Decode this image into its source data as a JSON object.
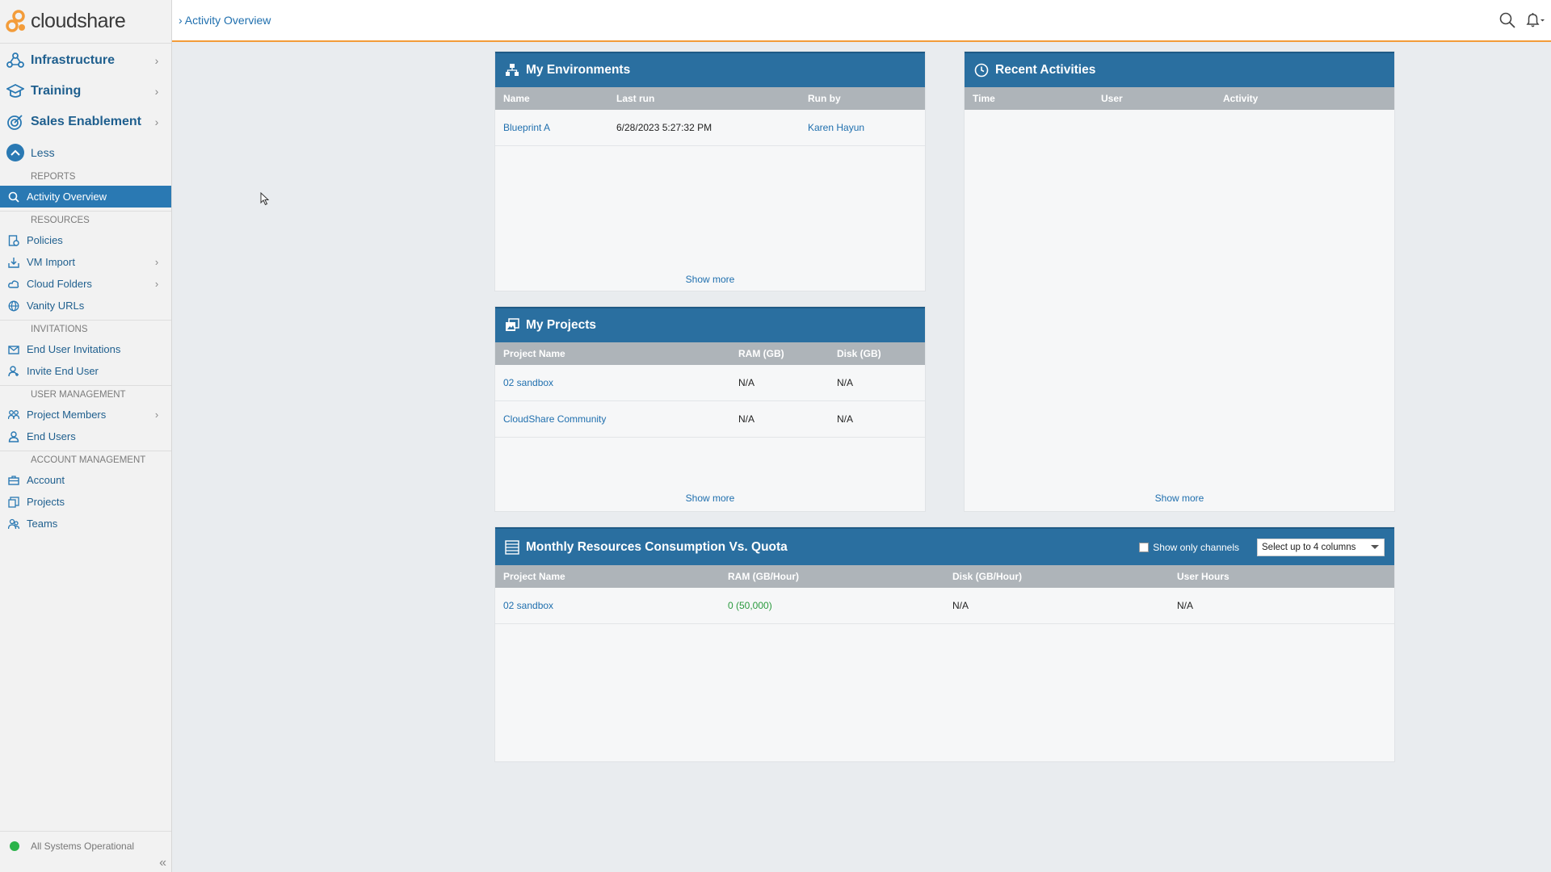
{
  "app": {
    "logo_text": "cloudshare",
    "brand_color": "#f39c3a",
    "accent_color": "#2a79b3"
  },
  "breadcrumb": {
    "separator": "›",
    "current": "Activity Overview"
  },
  "sidebar": {
    "main": [
      {
        "label": "Infrastructure",
        "icon": "infrastructure-icon"
      },
      {
        "label": "Training",
        "icon": "graduation-cap-icon"
      },
      {
        "label": "Sales Enablement",
        "icon": "target-icon"
      }
    ],
    "less_label": "Less",
    "sections": {
      "reports": "REPORTS",
      "resources": "RESOURCES",
      "invitations": "INVITATIONS",
      "user_management": "USER MANAGEMENT",
      "account_management": "ACCOUNT MANAGEMENT"
    },
    "items": {
      "activity_overview": "Activity Overview",
      "policies": "Policies",
      "vm_import": "VM Import",
      "cloud_folders": "Cloud Folders",
      "vanity_urls": "Vanity URLs",
      "end_user_invitations": "End User Invitations",
      "invite_end_user": "Invite End User",
      "project_members": "Project Members",
      "end_users": "End Users",
      "account": "Account",
      "projects": "Projects",
      "teams": "Teams"
    },
    "status": "All Systems Operational",
    "status_color": "#2bb34a"
  },
  "environments": {
    "title": "My Environments",
    "columns": [
      "Name",
      "Last run",
      "Run by"
    ],
    "rows": [
      {
        "name": "Blueprint A",
        "last_run": "6/28/2023 5:27:32 PM",
        "run_by": "Karen Hayun"
      }
    ],
    "show_more": "Show more"
  },
  "recent": {
    "title": "Recent Activities",
    "columns": [
      "Time",
      "User",
      "Activity"
    ],
    "show_more": "Show more"
  },
  "projects": {
    "title": "My Projects",
    "columns": [
      "Project Name",
      "RAM (GB)",
      "Disk (GB)"
    ],
    "rows": [
      {
        "name": "02 sandbox",
        "ram": "N/A",
        "disk": "N/A"
      },
      {
        "name": "CloudShare Community",
        "ram": "N/A",
        "disk": "N/A"
      }
    ],
    "show_more": "Show more"
  },
  "monthly": {
    "title": "Monthly Resources Consumption Vs. Quota",
    "checkbox_label": "Show only channels",
    "select_value": "Select up to 4 columns",
    "columns": [
      "Project Name",
      "RAM (GB/Hour)",
      "Disk (GB/Hour)",
      "User Hours"
    ],
    "rows": [
      {
        "name": "02 sandbox",
        "ram": "0 (50,000)",
        "disk": "N/A",
        "user_hours": "N/A"
      }
    ]
  }
}
